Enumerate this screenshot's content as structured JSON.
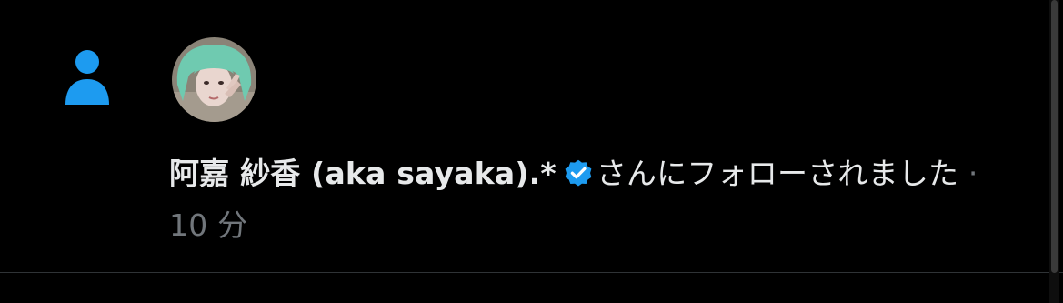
{
  "notification": {
    "type_icon": "person-icon",
    "avatar": "user-avatar",
    "user_name": "阿嘉 紗香 (aka sayaka).*",
    "verified_icon": "verified-badge-icon",
    "action_text": "さんにフォローされました",
    "separator": " · ",
    "time": "10 分"
  },
  "colors": {
    "background": "#000000",
    "text": "#e7e9ea",
    "secondary_text": "#71767b",
    "accent": "#1d9bf0",
    "divider": "#2f3336"
  }
}
